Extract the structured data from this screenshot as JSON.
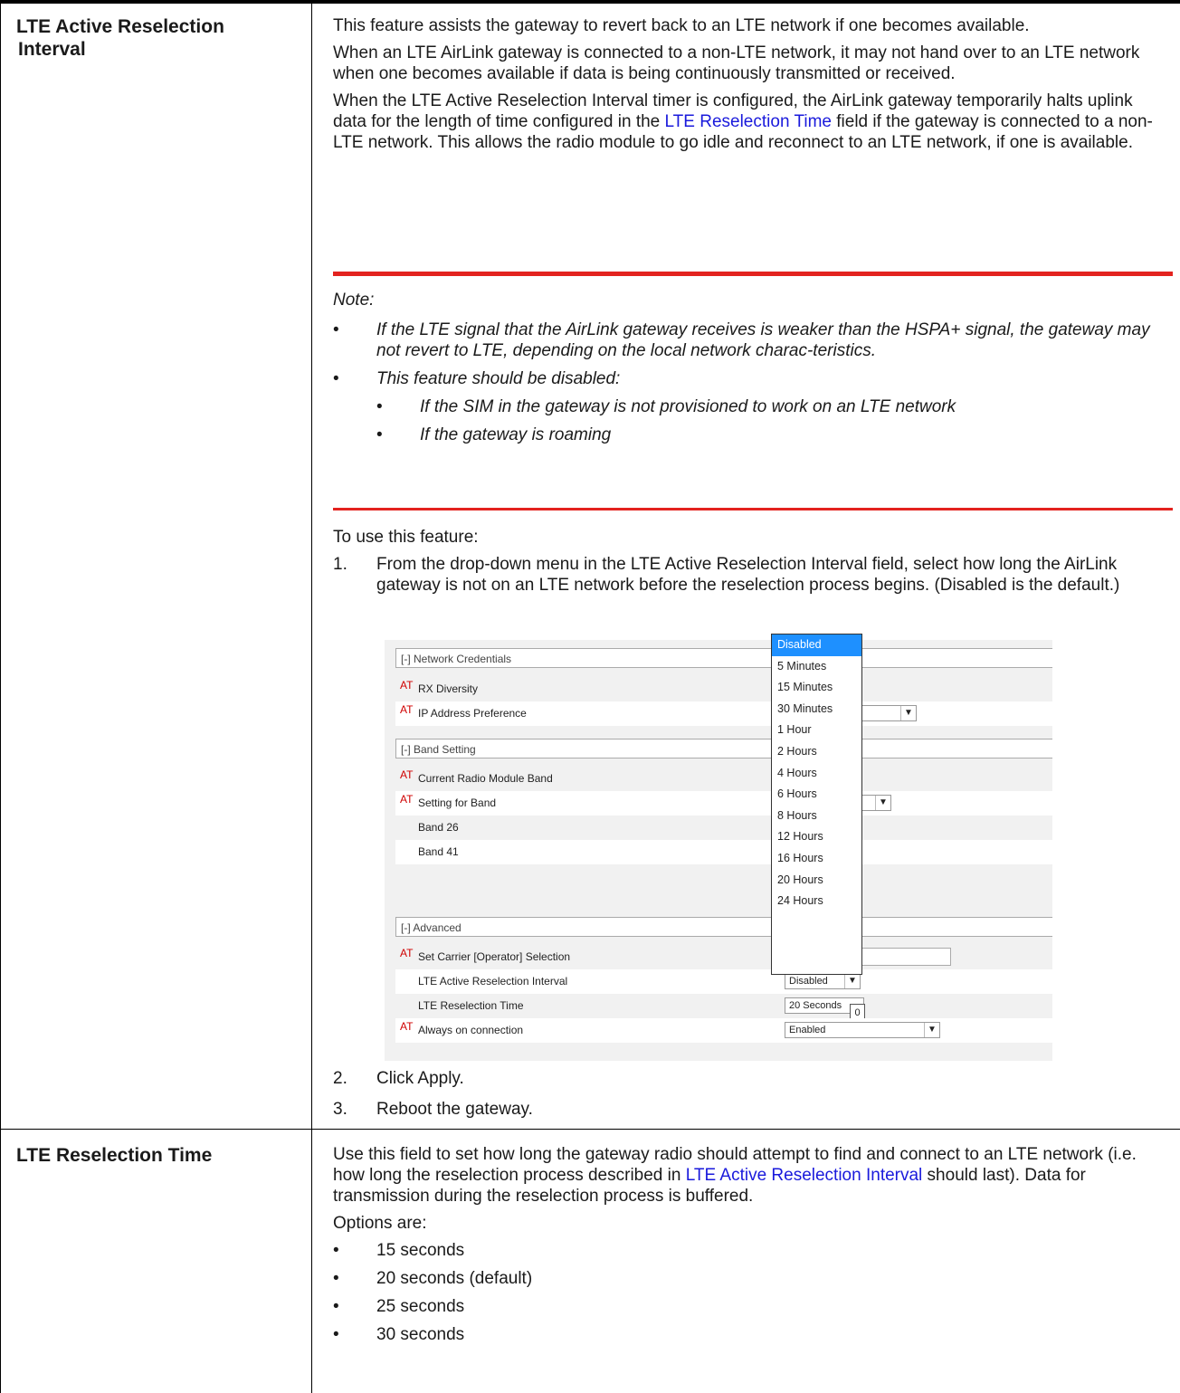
{
  "rows": [
    {
      "term": [
        "LTE Active Reselection",
        "Interval"
      ],
      "intro": "This feature assists the gateway to revert back to an LTE network if one becomes available.",
      "para2": "When an LTE AirLink gateway is connected to a non-LTE network, it may not hand over to an LTE network when one becomes available if data is being continuously transmitted or received.",
      "para3_a": "When the LTE Active Reselection Interval timer is configured, the AirLink gateway temporarily halts uplink data for the length of time configured in the ",
      "para3_link": "LTE Reselection Time",
      "para3_b": " field if the gateway is connected to a non-LTE network. This allows the radio module to go idle and reconnect to an LTE network, if one is available.",
      "note": {
        "label": "Note:",
        "bullet1": "If the LTE signal that the AirLink gateway receives is weaker than the HSPA+ signal, the gateway may not revert to LTE, depending on the local network charac-teristics.",
        "bullet2": "This feature should be disabled:",
        "sub1": "If the SIM in the gateway is not provisioned to work on an LTE network",
        "sub2": "If the gateway is roaming"
      },
      "steps_intro": "To use this feature:",
      "steps": [
        {
          "n": "1.",
          "text": "From the drop-down menu in the LTE Active Reselection Interval field, select how long the AirLink gateway is not on an LTE network before the reselection process begins. (Disabled is the default.)"
        },
        {
          "n": "2.",
          "text": "Click Apply."
        },
        {
          "n": "3.",
          "text": "Reboot the gateway."
        }
      ]
    },
    {
      "term": [
        "LTE Reselection Time"
      ],
      "desc_a": "Use this field to set how long the gateway radio should attempt to find and connect to an LTE network (i.e. how long the reselection process described in ",
      "desc_link": "LTE Active Reselection Interval",
      "desc_b": " should last). Data for transmission during the reselection process is buffered.",
      "options_label": "Options are:",
      "options": [
        "15 seconds",
        "20 seconds (default)",
        "25 seconds",
        "30 seconds"
      ]
    }
  ],
  "screenshot": {
    "at_label": "AT",
    "sections": [
      "[-] Network Credentials",
      "[-] Band Setting",
      "[-] Advanced"
    ],
    "fields": {
      "rx_diversity": "RX Diversity",
      "ip_pref": "IP Address Preference",
      "current_band": "Current Radio Module Band",
      "setting_band": "Setting for Band",
      "band26": "Band 26",
      "band41": "Band 41",
      "carrier_sel": "Set Carrier [Operator] Selection",
      "lte_active": "LTE Active Reselection Interval",
      "lte_time": "LTE Reselection Time",
      "always_on": "Always on connection"
    },
    "values": {
      "lte_active": "Disabled",
      "lte_time": "20 Seconds",
      "always_on": "Enabled",
      "spinner": "0"
    },
    "dropdown_options": [
      "Disabled",
      "5 Minutes",
      "15 Minutes",
      "30 Minutes",
      "1 Hour",
      "2 Hours",
      "4 Hours",
      "6 Hours",
      "8 Hours",
      "12 Hours",
      "16 Hours",
      "20 Hours",
      "24 Hours"
    ],
    "dropdown_selected": "Disabled"
  }
}
